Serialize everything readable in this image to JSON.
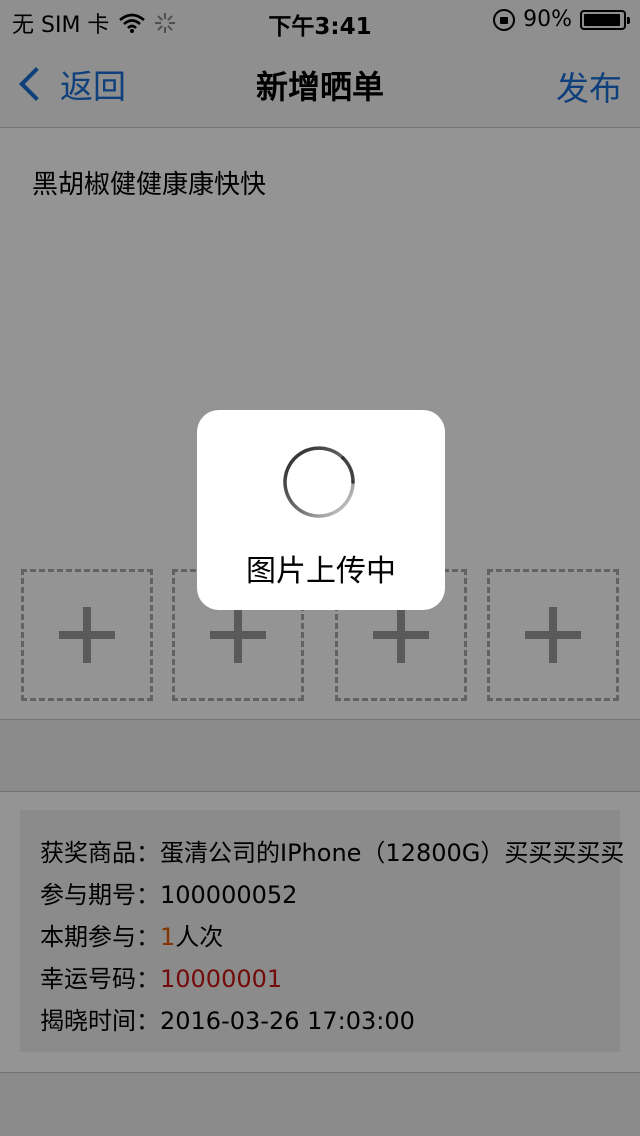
{
  "status_bar": {
    "carrier": "无 SIM 卡",
    "time": "下午3:41",
    "battery": "90%"
  },
  "nav": {
    "back_label": "返回",
    "title": "新增晒单",
    "publish_label": "发布"
  },
  "post": {
    "text": "黑胡椒健健康康快快"
  },
  "image_slots": [
    {
      "name": "add-image-slot-1"
    },
    {
      "name": "add-image-slot-2"
    },
    {
      "name": "add-image-slot-3"
    },
    {
      "name": "add-image-slot-4"
    }
  ],
  "info": {
    "prize_label": "获奖商品：",
    "prize_value": "蛋清公司的IPhone（12800G）买买买买买",
    "issue_label": "参与期号：",
    "issue_value": "100000052",
    "participation_label": "本期参与：",
    "participation_count": "1",
    "participation_unit": "人次",
    "lucky_label": "幸运号码：",
    "lucky_value": "10000001",
    "reveal_label": "揭晓时间：",
    "reveal_value": "2016-03-26 17:03:00"
  },
  "hud": {
    "message": "图片上传中"
  },
  "colors": {
    "accent": "#1a6fd6",
    "count_color": "#e05a00",
    "lucky_color": "#c81414"
  }
}
